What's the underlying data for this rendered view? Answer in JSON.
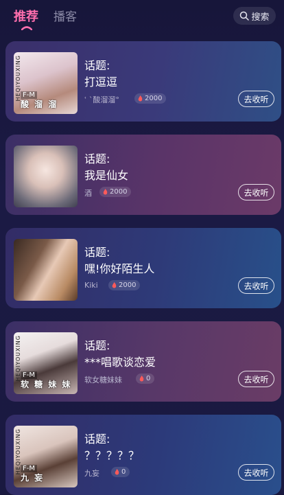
{
  "header": {
    "tabs": [
      {
        "label": "推荐",
        "active": true
      },
      {
        "label": "播客",
        "active": false
      }
    ],
    "search_label": "搜索"
  },
  "colors": {
    "accent": "#ff6fae",
    "background": "#17163a"
  },
  "rooms": [
    {
      "topic_label": "话题:",
      "title": "打逗逗",
      "host": "ʿ ˋ酸溜溜°",
      "heat": "2000",
      "listen_label": "去收听",
      "thumb_side_text": "HEQIYOUXING",
      "thumb_fm": "F-M",
      "thumb_name": "酸 溜 溜"
    },
    {
      "topic_label": "话题:",
      "title": "我是仙女",
      "host": "酒",
      "heat": "2000",
      "listen_label": "去收听"
    },
    {
      "topic_label": "话题:",
      "title": "嘿!你好陌生人",
      "host": "Kiki",
      "heat": "2000",
      "listen_label": "去收听"
    },
    {
      "topic_label": "话题:",
      "title": "***唱歌谈恋爱",
      "host": "软女糖妹妹",
      "heat": "0",
      "listen_label": "去收听",
      "thumb_side_text": "HEQIYOUXING",
      "thumb_fm": "F-M",
      "thumb_name": "软 糖 妹 妹"
    },
    {
      "topic_label": "话题:",
      "title": "？？？？？",
      "host": "九妄",
      "heat": "0",
      "listen_label": "去收听",
      "thumb_side_text": "HEQIYOUXING",
      "thumb_fm": "F-M",
      "thumb_name": "九 妄"
    }
  ]
}
